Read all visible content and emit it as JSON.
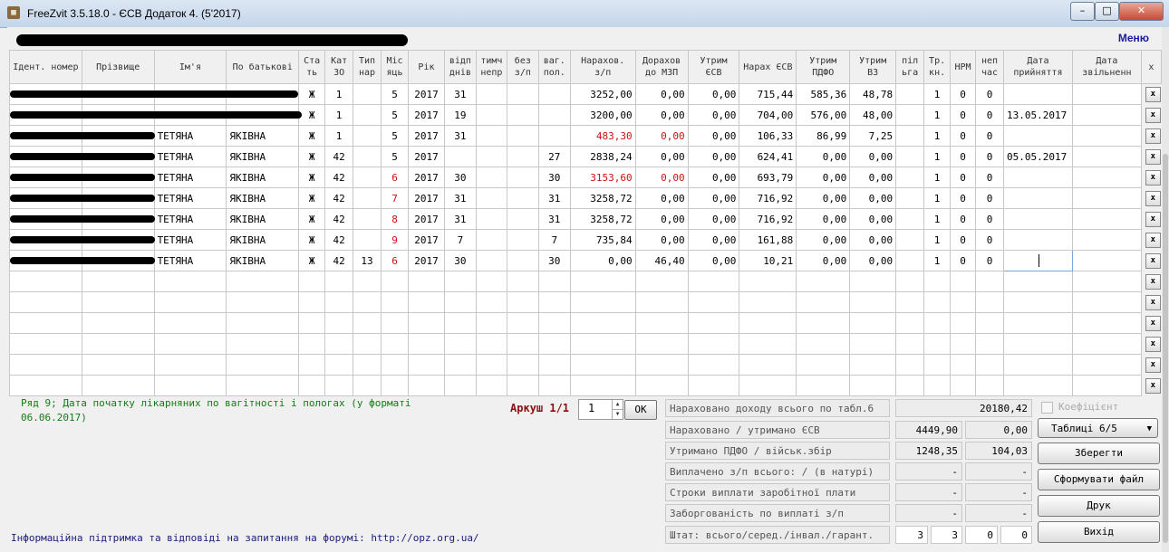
{
  "window": {
    "title": "FreeZvit 3.5.18.0 - ЄСВ Додаток 4. (5'2017)"
  },
  "menu_label": "Меню",
  "columns": [
    "Ідент. номер",
    "Прізвище",
    "Ім'я",
    "По батькові",
    "Ста ть",
    "Кат ЗО",
    "Тип нар",
    "Міс яць",
    "Рік",
    "відп днів",
    "тимч непр",
    "без з/п",
    "ваг. пол.",
    "Нарахов. з/п",
    "Дорахов до МЗП",
    "Утрим ЄСВ",
    "Нарах ЄСВ",
    "Утрим ПДФО",
    "Утрим ВЗ",
    "піл ьга",
    "Тр. кн.",
    "НРМ",
    "неп час",
    "Дата прийняття",
    "Дата звільненн",
    "х"
  ],
  "rows": [
    {
      "name": "",
      "patr": "",
      "sex": "Ж",
      "cat": "1",
      "typ": "",
      "month": "5",
      "month_red": false,
      "year": "2017",
      "vid": "31",
      "tymch": "",
      "bez": "",
      "vag": "",
      "nar": "3252,00",
      "nar_red": false,
      "dor": "0,00",
      "dor_red": false,
      "utr_esv": "0,00",
      "nar_esv": "715,44",
      "pdfo": "585,36",
      "vz": "48,78",
      "pilga": "",
      "trkn": "1",
      "nrm": "0",
      "nep": "0",
      "date_in": "",
      "date_out": "",
      "redact_w": 318
    },
    {
      "name": "",
      "patr": "",
      "sex": "Ж",
      "cat": "1",
      "typ": "",
      "month": "5",
      "month_red": false,
      "year": "2017",
      "vid": "19",
      "tymch": "",
      "bez": "",
      "vag": "",
      "nar": "3200,00",
      "nar_red": false,
      "dor": "0,00",
      "dor_red": false,
      "utr_esv": "0,00",
      "nar_esv": "704,00",
      "pdfo": "576,00",
      "vz": "48,00",
      "pilga": "",
      "trkn": "1",
      "nrm": "0",
      "nep": "0",
      "date_in": "13.05.2017",
      "date_out": "",
      "redact_w": 322
    },
    {
      "name": "ТЕТЯНА",
      "patr": "ЯКІВНА",
      "sex": "Ж",
      "cat": "1",
      "typ": "",
      "month": "5",
      "month_red": false,
      "year": "2017",
      "vid": "31",
      "tymch": "",
      "bez": "",
      "vag": "",
      "nar": "483,30",
      "nar_red": true,
      "dor": "0,00",
      "dor_red": true,
      "utr_esv": "0,00",
      "nar_esv": "106,33",
      "pdfo": "86,99",
      "vz": "7,25",
      "pilga": "",
      "trkn": "1",
      "nrm": "0",
      "nep": "0",
      "date_in": "",
      "date_out": "",
      "redact_w": 160
    },
    {
      "name": "ТЕТЯНА",
      "patr": "ЯКІВНА",
      "sex": "Ж",
      "cat": "42",
      "typ": "",
      "month": "5",
      "month_red": false,
      "year": "2017",
      "vid": "",
      "tymch": "",
      "bez": "",
      "vag": "27",
      "nar": "2838,24",
      "nar_red": false,
      "dor": "0,00",
      "dor_red": false,
      "utr_esv": "0,00",
      "nar_esv": "624,41",
      "pdfo": "0,00",
      "vz": "0,00",
      "pilga": "",
      "trkn": "1",
      "nrm": "0",
      "nep": "0",
      "date_in": "05.05.2017",
      "date_out": "",
      "redact_w": 160
    },
    {
      "name": "ТЕТЯНА",
      "patr": "ЯКІВНА",
      "sex": "Ж",
      "cat": "42",
      "typ": "",
      "month": "6",
      "month_red": true,
      "year": "2017",
      "vid": "30",
      "tymch": "",
      "bez": "",
      "vag": "30",
      "nar": "3153,60",
      "nar_red": true,
      "dor": "0,00",
      "dor_red": true,
      "utr_esv": "0,00",
      "nar_esv": "693,79",
      "pdfo": "0,00",
      "vz": "0,00",
      "pilga": "",
      "trkn": "1",
      "nrm": "0",
      "nep": "0",
      "date_in": "",
      "date_out": "",
      "redact_w": 160
    },
    {
      "name": "ТЕТЯНА",
      "patr": "ЯКІВНА",
      "sex": "Ж",
      "cat": "42",
      "typ": "",
      "month": "7",
      "month_red": true,
      "year": "2017",
      "vid": "31",
      "tymch": "",
      "bez": "",
      "vag": "31",
      "nar": "3258,72",
      "nar_red": false,
      "dor": "0,00",
      "dor_red": false,
      "utr_esv": "0,00",
      "nar_esv": "716,92",
      "pdfo": "0,00",
      "vz": "0,00",
      "pilga": "",
      "trkn": "1",
      "nrm": "0",
      "nep": "0",
      "date_in": "",
      "date_out": "",
      "redact_w": 160
    },
    {
      "name": "ТЕТЯНА",
      "patr": "ЯКІВНА",
      "sex": "Ж",
      "cat": "42",
      "typ": "",
      "month": "8",
      "month_red": true,
      "year": "2017",
      "vid": "31",
      "tymch": "",
      "bez": "",
      "vag": "31",
      "nar": "3258,72",
      "nar_red": false,
      "dor": "0,00",
      "dor_red": false,
      "utr_esv": "0,00",
      "nar_esv": "716,92",
      "pdfo": "0,00",
      "vz": "0,00",
      "pilga": "",
      "trkn": "1",
      "nrm": "0",
      "nep": "0",
      "date_in": "",
      "date_out": "",
      "redact_w": 160
    },
    {
      "name": "ТЕТЯНА",
      "patr": "ЯКІВНА",
      "sex": "Ж",
      "cat": "42",
      "typ": "",
      "month": "9",
      "month_red": true,
      "year": "2017",
      "vid": "7",
      "tymch": "",
      "bez": "",
      "vag": "7",
      "nar": "735,84",
      "nar_red": false,
      "dor": "0,00",
      "dor_red": false,
      "utr_esv": "0,00",
      "nar_esv": "161,88",
      "pdfo": "0,00",
      "vz": "0,00",
      "pilga": "",
      "trkn": "1",
      "nrm": "0",
      "nep": "0",
      "date_in": "",
      "date_out": "",
      "redact_w": 160
    },
    {
      "name": "ТЕТЯНА",
      "patr": "ЯКІВНА",
      "sex": "Ж",
      "cat": "42",
      "typ": "13",
      "month": "6",
      "month_red": true,
      "year": "2017",
      "vid": "30",
      "tymch": "",
      "bez": "",
      "vag": "30",
      "nar": "0,00",
      "nar_red": false,
      "dor": "46,40",
      "dor_red": false,
      "utr_esv": "0,00",
      "nar_esv": "10,21",
      "pdfo": "0,00",
      "vz": "0,00",
      "pilga": "",
      "trkn": "1",
      "nrm": "0",
      "nep": "0",
      "date_in": "",
      "date_out": "",
      "redact_w": 160,
      "active": true
    }
  ],
  "empty_rows": 6,
  "hint": "Ряд 9; Дата початку лікарняних по вагітності і пологах (у форматі 06.06.2017)",
  "sheet": {
    "label": "Аркуш 1/1",
    "value": "1",
    "ok": "ОК"
  },
  "summary": {
    "total_income_label": "Нараховано доходу всього по табл.6",
    "total_income": "20180,42",
    "esv_label": "Нараховано / утримано ЄСВ",
    "esv_accrued": "4449,90",
    "esv_withheld": "0,00",
    "pdfo_label": "Утримано ПДФО / військ.збір",
    "pdfo": "1248,35",
    "military": "104,03",
    "paid_label": "Виплачено з/п всього: / (в натурі)",
    "paid_total": "-",
    "paid_kind": "-",
    "pay_lines_label": "Строки виплати заробітної плати",
    "pay_lines_a": "-",
    "pay_lines_b": "-",
    "debt_label": "Заборгованість по виплаті з/п",
    "debt_a": "-",
    "debt_b": "-",
    "staff_label": "Штат: всього/серед./інвал./гарант.",
    "staff_total": "3",
    "staff_avg": "3",
    "staff_inv": "0",
    "staff_guar": "0"
  },
  "buttons": {
    "coef_label": "Коефіцієнт",
    "tables": "Таблиці 6/5",
    "save": "Зберегти",
    "generate": "Сформувати файл",
    "print": "Друк",
    "exit": "Вихід"
  },
  "footer": "Інформаційна підтримка та відповіді на запитання на форумі: http://opz.org.ua/"
}
